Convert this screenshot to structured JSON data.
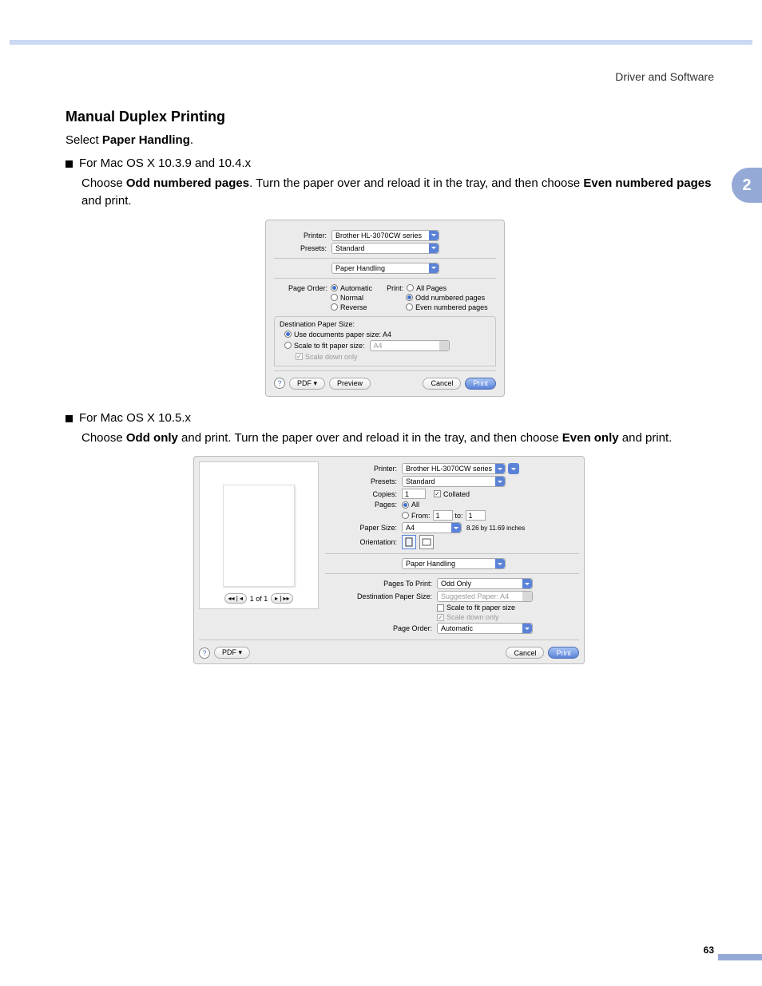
{
  "header": {
    "section": "Driver and Software",
    "chapter": "2"
  },
  "page": {
    "title": "Manual Duplex Printing",
    "select_prefix": "Select ",
    "select_bold": "Paper Handling",
    "select_suffix": ".",
    "b1": "For Mac OS X 10.3.9 and 10.4.x",
    "p1a": "Choose ",
    "p1b": "Odd numbered pages",
    "p1c": ". Turn the paper over and reload it in the tray, and then choose ",
    "p1d": "Even numbered pages",
    "p1e": " and print.",
    "b2": "For Mac OS X 10.5.x",
    "p2a": "Choose ",
    "p2b": "Odd only",
    "p2c": " and print. Turn the paper over and reload it in the tray, and then choose ",
    "p2d": "Even only",
    "p2e": " and print.",
    "number": "63"
  },
  "dialog1": {
    "printer_label": "Printer:",
    "printer_value": "Brother HL-3070CW series",
    "presets_label": "Presets:",
    "presets_value": "Standard",
    "pane_value": "Paper Handling",
    "page_order_label": "Page Order:",
    "po_auto": "Automatic",
    "po_normal": "Normal",
    "po_reverse": "Reverse",
    "print_label": "Print:",
    "pr_all": "All Pages",
    "pr_odd": "Odd numbered pages",
    "pr_even": "Even numbered pages",
    "dest_label": "Destination Paper Size:",
    "use_doc": "Use documents paper size:  A4",
    "scale_fit": "Scale to fit paper size:",
    "scale_value": "A4",
    "scale_down": "Scale down only",
    "pdf": "PDF ▾",
    "preview": "Preview",
    "cancel": "Cancel",
    "print": "Print"
  },
  "dialog2": {
    "printer_label": "Printer:",
    "printer_value": "Brother HL-3070CW series",
    "presets_label": "Presets:",
    "presets_value": "Standard",
    "copies_label": "Copies:",
    "copies_value": "1",
    "collated": "Collated",
    "pages_label": "Pages:",
    "pages_all": "All",
    "pages_from": "From:",
    "from_val": "1",
    "pages_to": "to:",
    "to_val": "1",
    "papersize_label": "Paper Size:",
    "papersize_value": "A4",
    "papersize_dims": "8.26 by 11.69 inches",
    "orientation_label": "Orientation:",
    "pane_value": "Paper Handling",
    "pages_to_print_label": "Pages To Print:",
    "pages_to_print_value": "Odd Only",
    "dest_label": "Destination Paper Size:",
    "dest_value": "Suggested Paper: A4",
    "scale_fit": "Scale to fit paper size",
    "scale_down": "Scale down only",
    "page_order_label": "Page Order:",
    "page_order_value": "Automatic",
    "preview_counter": "1 of 1",
    "pdf": "PDF ▾",
    "cancel": "Cancel",
    "print": "Print"
  }
}
